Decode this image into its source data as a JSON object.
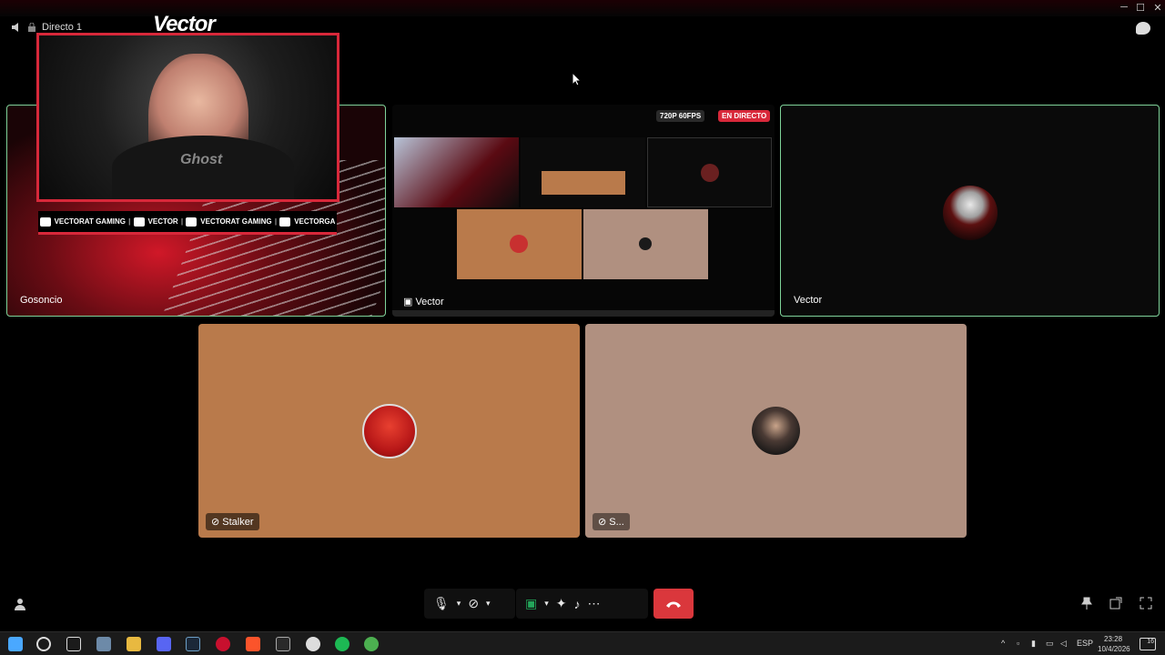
{
  "window": {
    "channel_name": "Directo 1",
    "minimize": "─",
    "maximize": "☐",
    "close": "✕"
  },
  "overlay": {
    "logo_text": "Vector",
    "shirt_text": "Ghost",
    "socials": [
      {
        "icon": "youtube-icon",
        "label": "VECTORAT GAMING"
      },
      {
        "icon": "twitch-icon",
        "label": "VECTOR"
      },
      {
        "icon": "twitter-icon",
        "label": "VECTORAT GAMING"
      },
      {
        "icon": "instagram-icon",
        "label": "VECTORGA"
      }
    ]
  },
  "tiles": [
    {
      "name": "Gosoncio",
      "speaking": true
    },
    {
      "name": "Vector",
      "stream": true,
      "quality_badge": "720P 60FPS",
      "live_badge": "EN DIRECTO"
    },
    {
      "name": "Vector",
      "speaking": true
    },
    {
      "name": "Stalker",
      "camera_off": true
    },
    {
      "name": "S...",
      "camera_off": true
    }
  ],
  "controls": [
    "mic-icon",
    "mic-options-chevron-icon",
    "camera-off-icon",
    "camera-options-chevron-icon",
    "screen-share-icon",
    "share-options-chevron-icon",
    "activities-icon",
    "soundboard-icon",
    "more-icon",
    "hang-up-icon"
  ],
  "taskbar": {
    "language": "ESP",
    "time": "23:28",
    "date": "10/4/2026",
    "notification_count": "16"
  },
  "colors": {
    "speaking_border": "#7fd39a",
    "live_red": "#d8283a",
    "hangup_red": "#da373c",
    "stalker_bg": "#b97a4b",
    "s_bg": "#b09080"
  }
}
